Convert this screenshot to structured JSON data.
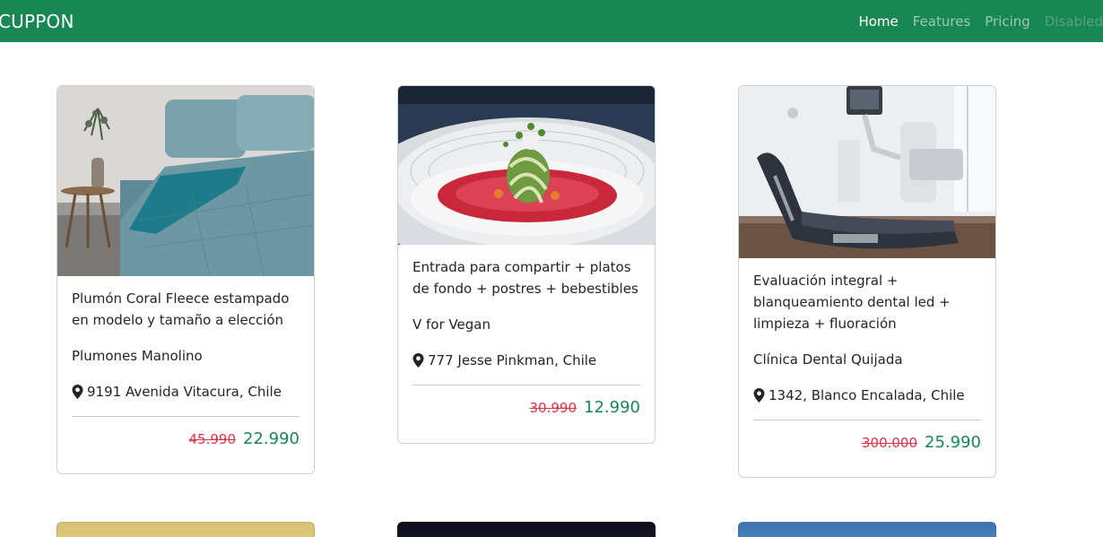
{
  "navbar": {
    "brand": "CUPPON",
    "links": [
      {
        "label": "Home"
      },
      {
        "label": "Features"
      },
      {
        "label": "Pricing"
      },
      {
        "label": "Disabled"
      }
    ]
  },
  "cards": [
    {
      "image": "bedding-photo",
      "title": "Plumón Coral Fleece estampado en modelo y tamaño a elección",
      "merchant": "Plumones Manolino",
      "location": "9191 Avenida Vitacura, Chile",
      "old_price": "45.990",
      "new_price": "22.990"
    },
    {
      "image": "dish-photo",
      "title": "Entrada para compartir + platos de fondo + postres + bebestibles",
      "merchant": "V for Vegan",
      "location": "777 Jesse Pinkman, Chile",
      "old_price": "30.990",
      "new_price": "12.990"
    },
    {
      "image": "dental-chair-photo",
      "title": "Evaluación integral + blanqueamiento dental led + limpieza + fluoración",
      "merchant": "Clínica Dental Quijada",
      "location": "1342, Blanco Encalada, Chile",
      "old_price": "300.000",
      "new_price": "25.990"
    }
  ],
  "colors": {
    "navbar": "#198754",
    "old_price": "#dc3545",
    "new_price": "#198754"
  }
}
